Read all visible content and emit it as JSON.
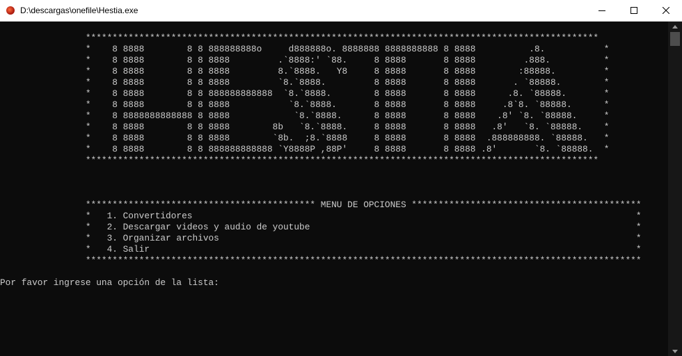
{
  "window": {
    "title": "D:\\descargas\\onefile\\Hestia.exe",
    "icon": "app-icon"
  },
  "controls": {
    "minimize": "minimize-icon",
    "maximize": "maximize-icon",
    "close": "close-icon"
  },
  "banner": {
    "lines": [
      "                ************************************************************************************************",
      "                *    8 8888        8 8 888888888o     d888888o. 8888888 8888888888 8 8888          .8.           *",
      "                *    8 8888        8 8 8888         .`8888:' `88.     8 8888       8 8888         .888.          *",
      "                *    8 8888        8 8 8888         8.`8888.   Y8     8 8888       8 8888        :88888.         *",
      "                *    8 8888        8 8 8888         `8.`8888.         8 8888       8 8888       . `88888.        *",
      "                *    8 8888        8 8 888888888888  `8.`8888.        8 8888       8 8888      .8. `88888.       *",
      "                *    8 8888        8 8 8888           `8.`8888.       8 8888       8 8888     .8`8. `88888.      *",
      "                *    8 8888888888888 8 8888            `8.`8888.      8 8888       8 8888    .8' `8. `88888.     *",
      "                *    8 8888        8 8 8888        8b   `8.`8888.     8 8888       8 8888   .8'   `8. `88888.    *",
      "                *    8 8888        8 8 8888        `8b.  ;8.`8888     8 8888       8 8888  .888888888. `88888.   *",
      "                *    8 8888        8 8 888888888888 `Y8888P ,88P'     8 8888       8 8888 .8'       `8. `88888.  *",
      "                ************************************************************************************************"
    ]
  },
  "menu": {
    "header": "                ******************************************* MENU DE OPCIONES *******************************************",
    "items": [
      "                *   1. Convertidores                                                                                   *",
      "                *   2. Descargar videos y audio de youtube                                                             *",
      "                *   3. Organizar archivos                                                                              *",
      "                *   4. Salir                                                                                           *"
    ],
    "footer": "                ********************************************************************************************************"
  },
  "prompt": "Por favor ingrese una opción de la lista:"
}
